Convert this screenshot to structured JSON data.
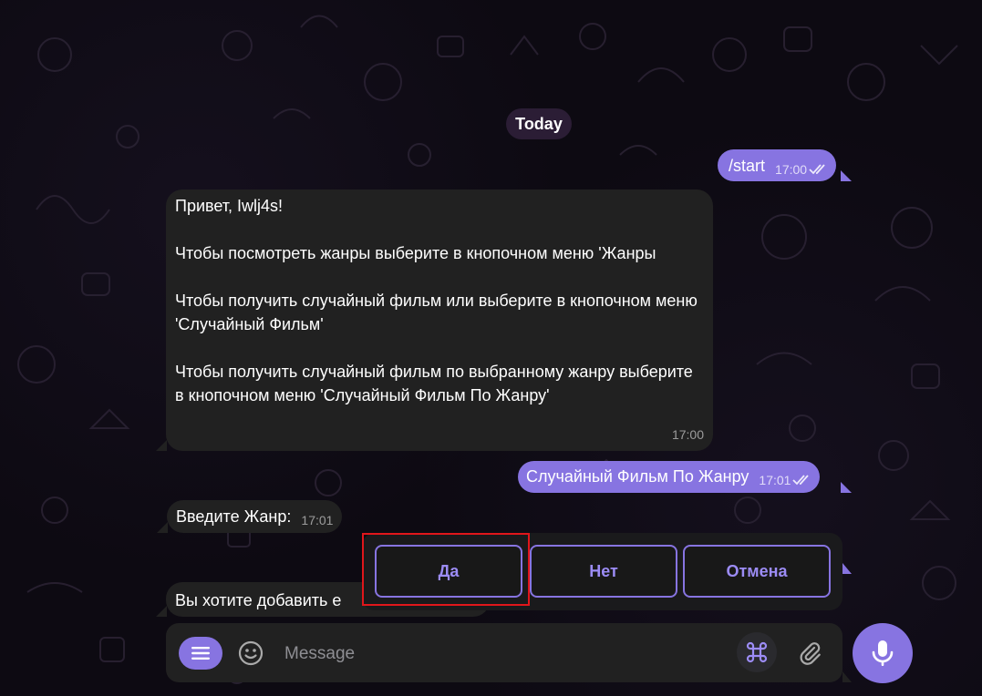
{
  "chat": {
    "date_label": "Today",
    "messages": [
      {
        "text": "/start",
        "time": "17:00"
      },
      {
        "text": "Привет, Iwlj4s!\n\nЧтобы посмотреть жанры выберите в кнопочном меню 'Жанры\n\nЧтобы получить случайный фильм или выберите в кнопочном меню 'Случайный Фильм'\n\nЧтобы получить случайный фильм по выбранному жанру выберите в кнопочном меню 'Случайный Фильм По Жанру'",
        "time": "17:00"
      },
      {
        "text": "Случайный Фильм По Жанру",
        "time": "17:01"
      },
      {
        "text": "Введите Жанр:",
        "time": "17:01"
      },
      {
        "text": "Вы хотите добавить е"
      }
    ]
  },
  "keyboard": {
    "buttons": [
      {
        "label": "Да"
      },
      {
        "label": "Нет"
      },
      {
        "label": "Отмена"
      }
    ]
  },
  "composer": {
    "placeholder": "Message"
  },
  "icons": {
    "menu": "menu-icon",
    "emoji": "smiley-icon",
    "commands": "command-icon",
    "attach": "paperclip-icon",
    "mic": "microphone-icon",
    "read": "double-check-icon"
  },
  "colors": {
    "accent": "#8774e1",
    "incoming_bubble": "#212121",
    "background": "#0d0a12",
    "highlight": "#e0161b"
  }
}
